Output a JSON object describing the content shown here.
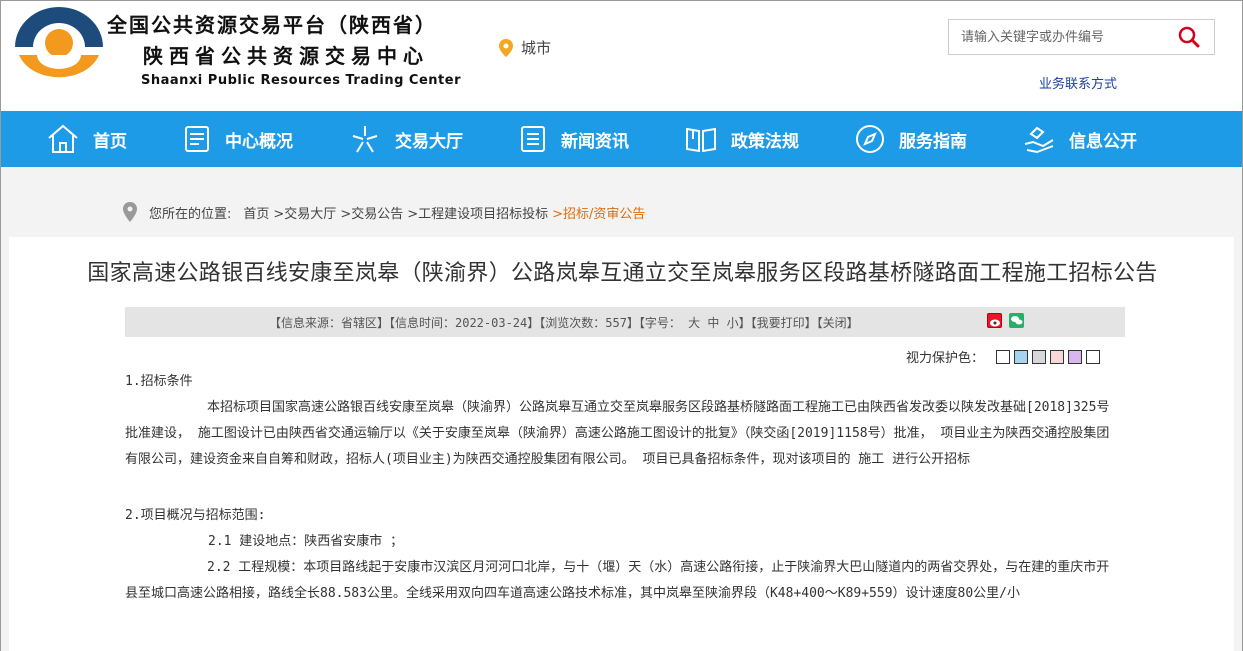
{
  "header": {
    "title_cn_line1": "全国公共资源交易平台（陕西省）",
    "title_cn_line2": "陕西省公共资源交易中心",
    "title_en": "Shaanxi Public Resources Trading Center",
    "city_label": "城市",
    "search_placeholder": "请输入关键字或办件编号",
    "biz_contact": "业务联系方式"
  },
  "nav": {
    "items": [
      {
        "label": "首页",
        "icon": "home-icon"
      },
      {
        "label": "中心概况",
        "icon": "document-icon"
      },
      {
        "label": "交易大厅",
        "icon": "star-icon"
      },
      {
        "label": "新闻资讯",
        "icon": "list-icon"
      },
      {
        "label": "政策法规",
        "icon": "book-icon"
      },
      {
        "label": "服务指南",
        "icon": "compass-icon"
      },
      {
        "label": "信息公开",
        "icon": "hand-icon"
      }
    ],
    "color": "#1e9be6"
  },
  "breadcrumb": {
    "prefix": "您所在的位置:",
    "items": [
      "首页",
      ">交易大厅",
      ">交易公告",
      ">工程建设项目招标投标",
      ">招标/资审公告"
    ]
  },
  "article": {
    "title": "国家高速公路银百线安康至岚皋（陕渝界）公路岚皋互通立交至岚皋服务区段路基桥隧路面工程施工招标公告",
    "meta": "【信息来源：省辖区】【信息时间：2022-03-24】【浏览次数：557】【字号： 大 中 小】【我要打印】【关闭】",
    "eye_protect_label": "视力保护色：",
    "eye_colors": [
      "#ffffff",
      "#a6d4ee",
      "#d8d8d8",
      "#f7d8d8",
      "#d6b8ee",
      "#ffffff"
    ],
    "paragraphs": [
      "1.招标条件",
      "本招标项目国家高速公路银百线安康至岚皋（陕渝界）公路岚皋互通立交至岚皋服务区段路基桥隧路面工程施工已由陕西省发改委以陕发改基础[2018]325号批准建设， 施工图设计已由陕西省交通运输厅以《关于安康至岚皋（陕渝界）高速公路施工图设计的批复》（陕交函[2019]1158号）批准， 项目业主为陕西交通控股集团有限公司，建设资金来自自筹和财政，招标人(项目业主)为陕西交通控股集团有限公司。 项目已具备招标条件，现对该项目的 施工 进行公开招标",
      "2.项目概况与招标范围:",
      "2.1 建设地点：陕西省安康市 ；",
      "2.2 工程规模：本项目路线起于安康市汉滨区月河河口北岸，与十（堰）天（水）高速公路衔接，止于陕渝界大巴山隧道内的两省交界处，与在建的重庆市开县至城口高速公路相接，路线全长88.583公里。全线采用双向四车道高速公路技术标准，其中岚皋至陕渝界段（K48+400～K89+559）设计速度80公里/小"
    ]
  }
}
